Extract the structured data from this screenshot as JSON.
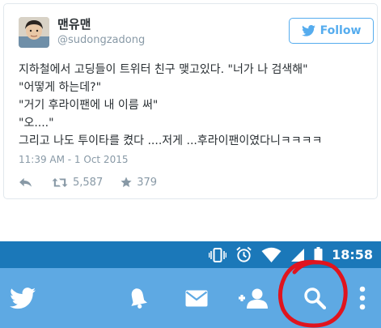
{
  "tweet": {
    "display_name": "맨유맨",
    "handle": "@sudongzadong",
    "follow_label": "Follow",
    "text_lines": [
      "지하철에서 고딩들이 트위터 친구 맺고있다. \"너가 나 검색해\"",
      "\"어떻게 하는데?\"",
      "\"거기 후라이팬에 내 이름 써\"",
      "\"오....\"",
      "그리고 나도 투이타를 켰다 ....저게 ...후라이팬이였다니ㅋㅋㅋㅋ"
    ],
    "timestamp": "11:39 AM - 1 Oct 2015",
    "retweet_count": "5,587",
    "like_count": "379",
    "colors": {
      "accent": "#55acee",
      "muted": "#8899a6",
      "text": "#292f33"
    }
  },
  "status_bar": {
    "time": "18:58",
    "icons": [
      "vibrate-icon",
      "alarm-icon",
      "wifi-icon",
      "signal-icon",
      "battery-icon"
    ],
    "background": "#1b78b9"
  },
  "nav_bar": {
    "items": [
      "twitter-logo-icon",
      "notifications-bell-icon",
      "messages-envelope-icon",
      "add-user-icon",
      "search-icon",
      "more-vertical-icon"
    ],
    "background": "#5ea9e3"
  },
  "annotation": {
    "color": "#e0141e"
  }
}
